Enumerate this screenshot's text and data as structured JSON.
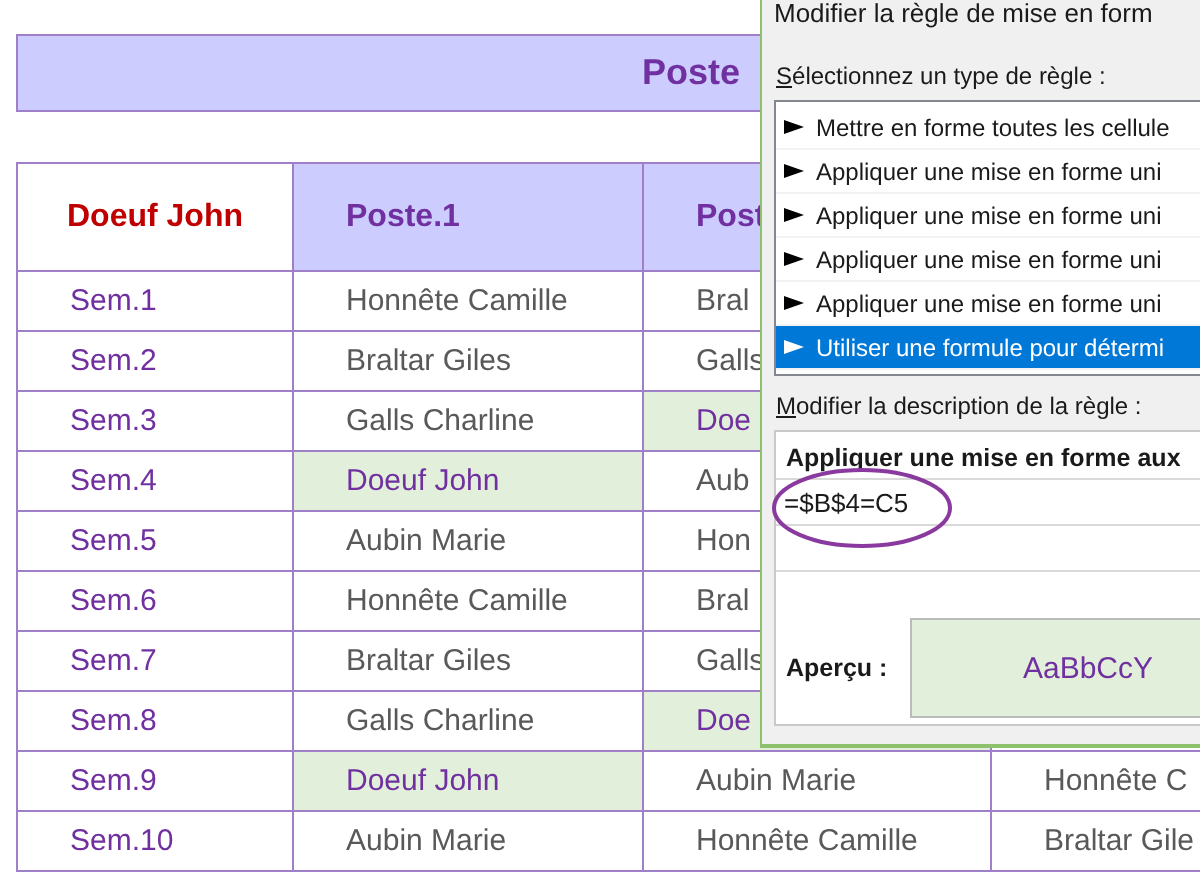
{
  "sheet": {
    "title": "Poste",
    "corner_header": "Doeuf John",
    "columns": [
      "Poste.1",
      "Post"
    ],
    "rows": [
      {
        "label": "Sem.1",
        "cells": [
          {
            "text": "Honnête Camille",
            "highlighted": false
          },
          {
            "text": "Bral",
            "highlighted": false
          }
        ]
      },
      {
        "label": "Sem.2",
        "cells": [
          {
            "text": "Braltar Giles",
            "highlighted": false
          },
          {
            "text": "Galls",
            "highlighted": false
          }
        ]
      },
      {
        "label": "Sem.3",
        "cells": [
          {
            "text": "Galls Charline",
            "highlighted": false
          },
          {
            "text": "Doe",
            "highlighted": true
          }
        ]
      },
      {
        "label": "Sem.4",
        "cells": [
          {
            "text": "Doeuf John",
            "highlighted": true
          },
          {
            "text": "Aub",
            "highlighted": false
          }
        ]
      },
      {
        "label": "Sem.5",
        "cells": [
          {
            "text": "Aubin Marie",
            "highlighted": false
          },
          {
            "text": "Hon",
            "highlighted": false
          }
        ]
      },
      {
        "label": "Sem.6",
        "cells": [
          {
            "text": "Honnête Camille",
            "highlighted": false
          },
          {
            "text": "Bral",
            "highlighted": false
          }
        ]
      },
      {
        "label": "Sem.7",
        "cells": [
          {
            "text": "Braltar Giles",
            "highlighted": false
          },
          {
            "text": "Galls",
            "highlighted": false
          }
        ]
      },
      {
        "label": "Sem.8",
        "cells": [
          {
            "text": "Galls Charline",
            "highlighted": false
          },
          {
            "text": "Doe",
            "highlighted": true
          }
        ]
      },
      {
        "label": "Sem.9",
        "cells": [
          {
            "text": "Doeuf John",
            "highlighted": true
          },
          {
            "text": "Aubin Marie",
            "highlighted": false
          },
          {
            "text": "Honnête C",
            "highlighted": false
          }
        ]
      },
      {
        "label": "Sem.10",
        "cells": [
          {
            "text": "Aubin Marie",
            "highlighted": false
          },
          {
            "text": "Honnête Camille",
            "highlighted": false
          },
          {
            "text": "Braltar Gile",
            "highlighted": false
          }
        ]
      }
    ]
  },
  "dialog": {
    "title": "Modifier la règle de mise en form",
    "rule_type_label": "Sélectionnez un type de règle :",
    "rule_types": [
      {
        "text": "Mettre en forme toutes les cellule",
        "selected": false
      },
      {
        "text": "Appliquer une mise en forme uni",
        "selected": false
      },
      {
        "text": "Appliquer une mise en forme uni",
        "selected": false
      },
      {
        "text": "Appliquer une mise en forme uni",
        "selected": false
      },
      {
        "text": "Appliquer une mise en forme uni",
        "selected": false
      },
      {
        "text": "Utiliser une formule pour détermi",
        "selected": true
      }
    ],
    "description_label": "Modifier la description de la règle :",
    "formula_label": "Appliquer une mise en forme aux",
    "formula": "=$B$4=C5",
    "preview_label": "Aperçu :",
    "preview_text": "AaBbCcY"
  }
}
